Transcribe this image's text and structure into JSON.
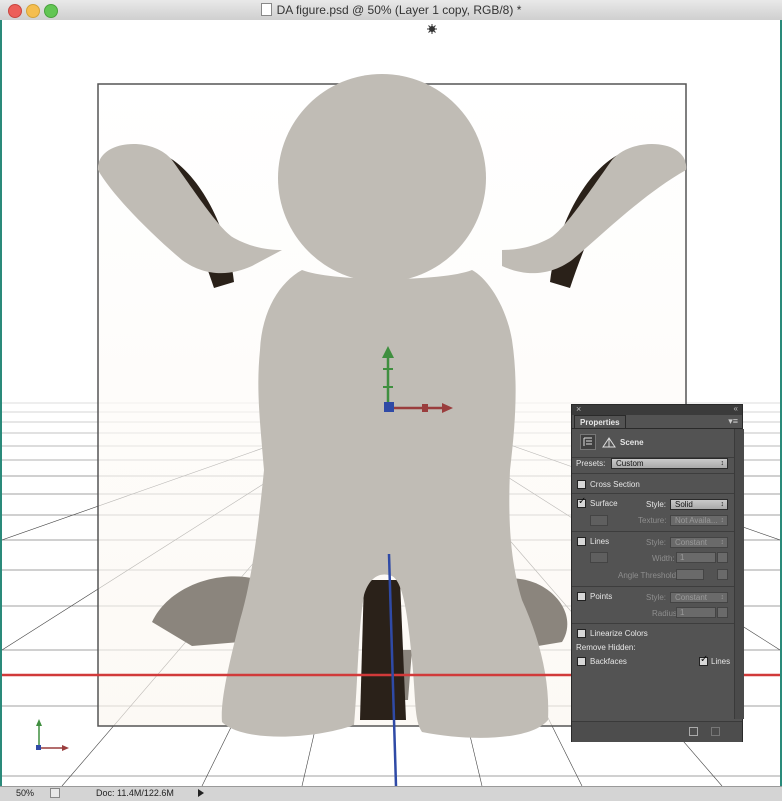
{
  "window": {
    "title": "DA figure.psd @ 50% (Layer 1 copy, RGB/8) *"
  },
  "statusbar": {
    "zoom": "50%",
    "doc_info": "Doc: 11.4M/122.6M"
  },
  "panel": {
    "close_glyph": "×",
    "collapse_glyph": "«",
    "menu_glyph": "▾≡",
    "tab": "Properties",
    "scene_label": "Scene",
    "presets_label": "Presets:",
    "presets_value": "Custom",
    "cross_section": {
      "label": "Cross Section",
      "checked": false
    },
    "surface": {
      "label": "Surface",
      "checked": true,
      "style_label": "Style:",
      "style_value": "Solid",
      "texture_label": "Texture:",
      "texture_value": "Not Availa..."
    },
    "lines": {
      "label": "Lines",
      "checked": false,
      "style_label": "Style:",
      "style_value": "Constant",
      "width_label": "Width:",
      "width_value": "1",
      "angle_label": "Angle Threshold:"
    },
    "points": {
      "label": "Points",
      "checked": false,
      "style_label": "Style:",
      "style_value": "Constant",
      "radius_label": "Radius:",
      "radius_value": "1"
    },
    "linearize": {
      "label": "Linearize Colors",
      "checked": false
    },
    "remove_hidden_label": "Remove Hidden:",
    "backfaces": {
      "label": "Backfaces",
      "checked": false
    },
    "hidden_lines": {
      "label": "Lines",
      "checked": true
    }
  },
  "colors": {
    "figure": "#c0bcb5",
    "shadow": "#8b857d",
    "x_axis": "#d13a3a",
    "y_axis": "#2f4aa6",
    "gizmo_y": "#3f8f3f",
    "gizmo_x": "#9a3d3d"
  },
  "icons": [
    "light-icon",
    "scene-icon",
    "environment-icon",
    "gizmo-icon",
    "axis-widget-icon",
    "render-icon",
    "delete-icon"
  ]
}
